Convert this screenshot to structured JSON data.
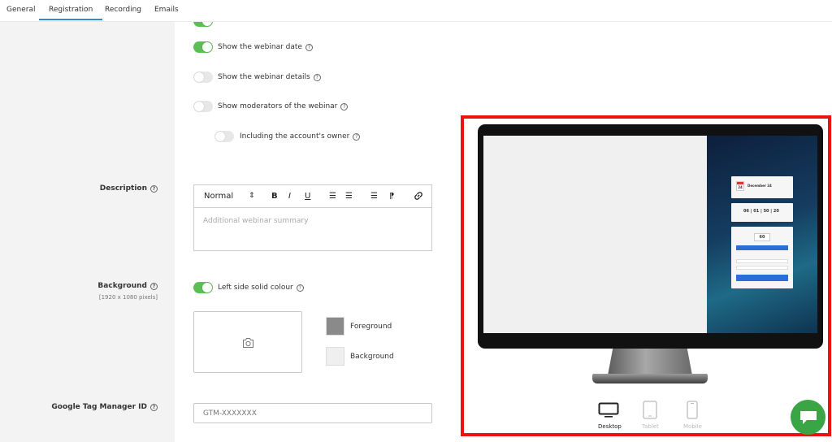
{
  "tabs": [
    {
      "label": "General",
      "active": false
    },
    {
      "label": "Registration",
      "active": true
    },
    {
      "label": "Recording",
      "active": false
    },
    {
      "label": "Emails",
      "active": false
    }
  ],
  "options": {
    "show_date": {
      "label": "Show the webinar date",
      "on": true
    },
    "show_details": {
      "label": "Show the webinar details",
      "on": false
    },
    "show_moderators": {
      "label": "Show moderators of the webinar",
      "on": false
    },
    "include_owner": {
      "label": "Including the account's owner",
      "on": false
    }
  },
  "description": {
    "label": "Description",
    "toolbar": {
      "format": "Normal",
      "format_arrow": "⇕",
      "bold": "B",
      "italic": "I",
      "underline": "U",
      "ordered_list": "☰",
      "bullet_list": "☰",
      "align": "☰",
      "direction": "⁋"
    },
    "placeholder": "Additional webinar summary"
  },
  "background": {
    "label": "Background",
    "hint": "[1920 x 1080 pixels]",
    "left_solid": {
      "label": "Left side solid colour",
      "on": true
    },
    "foreground_label": "Foreground",
    "background_label": "Background",
    "foreground_color": "#8a8a8a",
    "background_color": "#efefef"
  },
  "gtm": {
    "label": "Google Tag Manager ID",
    "placeholder": "GTM-XXXXXXX"
  },
  "preview": {
    "card_date_day": "24",
    "card_date_text": "December 24",
    "countdown": [
      "06",
      "01",
      "50",
      "20"
    ],
    "seats": "60",
    "devices": [
      {
        "label": "Desktop",
        "active": true
      },
      {
        "label": "Tablet",
        "active": false
      },
      {
        "label": "Mobile",
        "active": false
      }
    ]
  },
  "colors": {
    "accent": "#2b8fd6",
    "toggle_on": "#5cbf56",
    "highlight": "#ee1111",
    "chat": "#3aa545"
  }
}
